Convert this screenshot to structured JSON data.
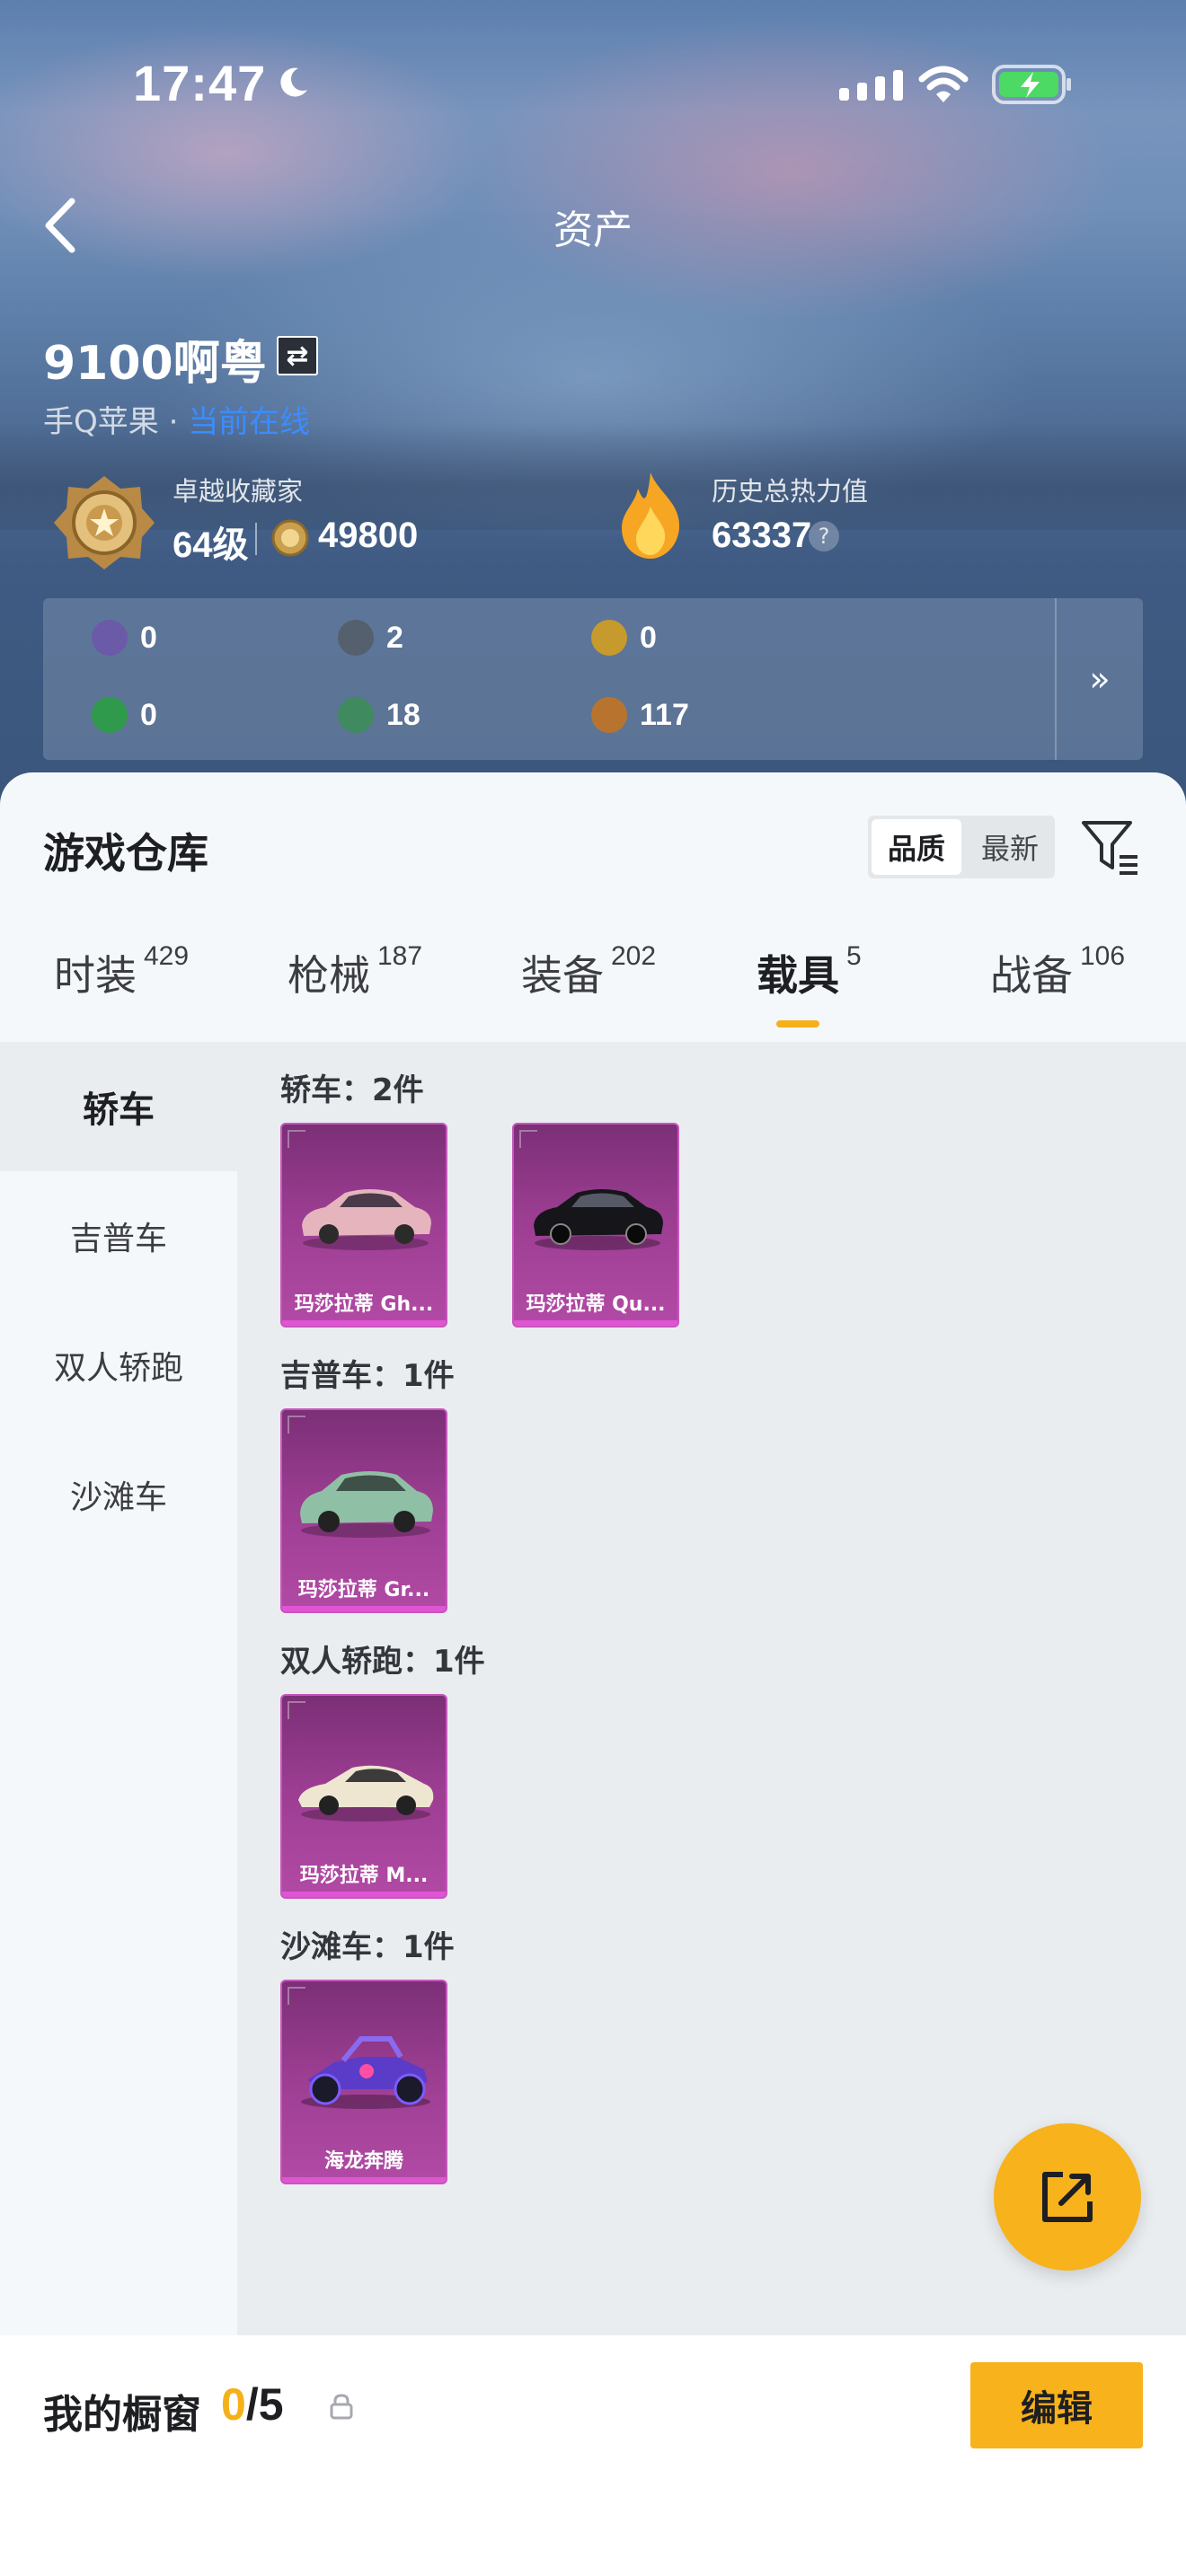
{
  "status_bar": {
    "time": "17:47"
  },
  "header": {
    "title": "资产"
  },
  "profile": {
    "name": "9100啊粤",
    "server": "手Q苹果 · ",
    "online_status": "当前在线",
    "collector_label": "卓越收藏家",
    "level": "64级",
    "coins": "49800",
    "heat_label": "历史总热力值",
    "heat_value": "63337",
    "help": "?"
  },
  "resources": {
    "items": [
      {
        "icon": "card-icon",
        "value": "0",
        "color": "#6a5aa8"
      },
      {
        "icon": "gear-coin-icon",
        "value": "2",
        "color": "#55606e"
      },
      {
        "icon": "gold-badge-icon",
        "value": "0",
        "color": "#c79a2e"
      },
      {
        "icon": "green-card-icon",
        "value": "0",
        "color": "#2f9a4c"
      },
      {
        "icon": "green-orb-icon",
        "value": "18",
        "color": "#3f8a5f"
      },
      {
        "icon": "bronze-orb-icon",
        "value": "117",
        "color": "#b8742e"
      }
    ],
    "more": "»"
  },
  "warehouse": {
    "title": "游戏仓库",
    "sort_options": [
      "品质",
      "最新"
    ],
    "tabs": [
      {
        "label": "时装",
        "count": "429"
      },
      {
        "label": "枪械",
        "count": "187"
      },
      {
        "label": "装备",
        "count": "202"
      },
      {
        "label": "载具",
        "count": "5"
      },
      {
        "label": "战备",
        "count": "106"
      }
    ],
    "active_tab": "载具",
    "sidebar": [
      "轿车",
      "吉普车",
      "双人轿跑",
      "沙滩车"
    ],
    "groups": [
      {
        "title": "轿车：2件",
        "items": [
          "玛莎拉蒂 Gh...",
          "玛莎拉蒂 Qu..."
        ]
      },
      {
        "title": "吉普车：1件",
        "items": [
          "玛莎拉蒂 Gr..."
        ]
      },
      {
        "title": "双人轿跑：1件",
        "items": [
          "玛莎拉蒂 M..."
        ]
      },
      {
        "title": "沙滩车：1件",
        "items": [
          "海龙奔腾"
        ]
      }
    ]
  },
  "showcase": {
    "title": "我的橱窗",
    "current": "0",
    "total": "/5",
    "edit_label": "编辑"
  },
  "colors": {
    "accent": "#f7b21c",
    "card_purple": "#9b3d91",
    "online_blue": "#3c8cff"
  }
}
